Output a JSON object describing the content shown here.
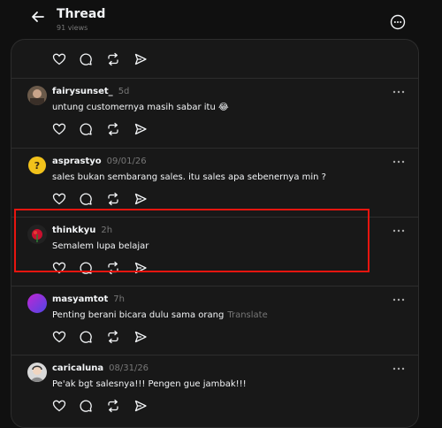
{
  "header": {
    "title": "Thread",
    "views": "91 views"
  },
  "posts": [
    {
      "username": "fairysunset_",
      "time": "5d",
      "text": "untung customernya masih sabar itu 😂"
    },
    {
      "username": "asprastyo",
      "time": "09/01/26",
      "text": "sales bukan sembarang sales. itu sales apa sebenernya min ?"
    },
    {
      "username": "thinkkyu",
      "time": "2h",
      "text": "Semalem lupa belajar"
    },
    {
      "username": "masyamtot",
      "time": "7h",
      "text": "Penting berani bicara dulu sama orang",
      "translate": "Translate"
    },
    {
      "username": "caricaluna",
      "time": "08/31/26",
      "text": "Pe'ak bgt salesnya!!! Pengen gue jambak!!!"
    }
  ],
  "colors": {
    "background": "#101010",
    "panel": "#181818",
    "highlight": "#e8150f",
    "muted": "#777777"
  }
}
